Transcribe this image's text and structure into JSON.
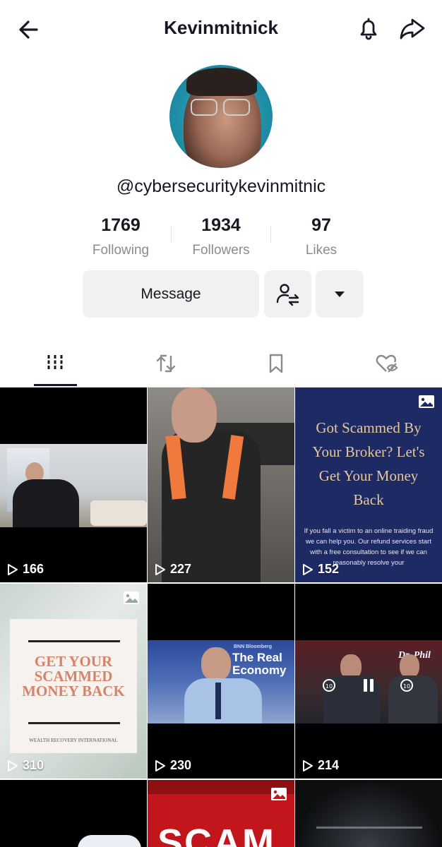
{
  "header": {
    "title": "Kevinmitnick",
    "back_icon": "arrow-left-icon",
    "bell_icon": "bell-icon",
    "share_icon": "share-arrow-icon"
  },
  "profile": {
    "handle": "@cybersecuritykevinmitnic",
    "avatar_icon": "profile-photo"
  },
  "stats": [
    {
      "value": "1769",
      "label": "Following"
    },
    {
      "value": "1934",
      "label": "Followers"
    },
    {
      "value": "97",
      "label": "Likes"
    }
  ],
  "actions": {
    "message_label": "Message",
    "follow_icon": "follow-user-swap-icon",
    "more_icon": "caret-down-icon"
  },
  "tabs": [
    {
      "icon": "videos-grid-icon",
      "active": true
    },
    {
      "icon": "repost-icon",
      "active": false
    },
    {
      "icon": "bookmark-icon",
      "active": false
    },
    {
      "icon": "liked-hidden-icon",
      "active": false
    }
  ],
  "videos": [
    {
      "views": "166"
    },
    {
      "views": "227"
    },
    {
      "views": "152",
      "is_photo": true,
      "text_title": "Got Scammed By Your Broker? Let's Get Your Money Back",
      "text_body": "If you fall a victim to an online traiding fraud we can help you. Our refund services start with a free consultation to see if we can reasonably resolve your"
    },
    {
      "views": "310",
      "is_photo": true,
      "text_title": "GET YOUR SCAMMED MONEY BACK",
      "text_brand": "WEALTH RECOVERY INTERNATIONAL"
    },
    {
      "views": "230",
      "text_brand": "BNN Bloomberg",
      "text_title": "The Real Economy"
    },
    {
      "views": "214",
      "text_brand": "Dr. Phil"
    },
    {
      "views": ""
    },
    {
      "views": "",
      "is_photo": true,
      "text_title": "SCAM"
    },
    {
      "views": ""
    }
  ],
  "colors": {
    "text": "#161823",
    "muted": "#8a8b91",
    "button_bg": "#f1f1f2",
    "navy": "#1e2a63",
    "gold": "#e6c79a"
  }
}
